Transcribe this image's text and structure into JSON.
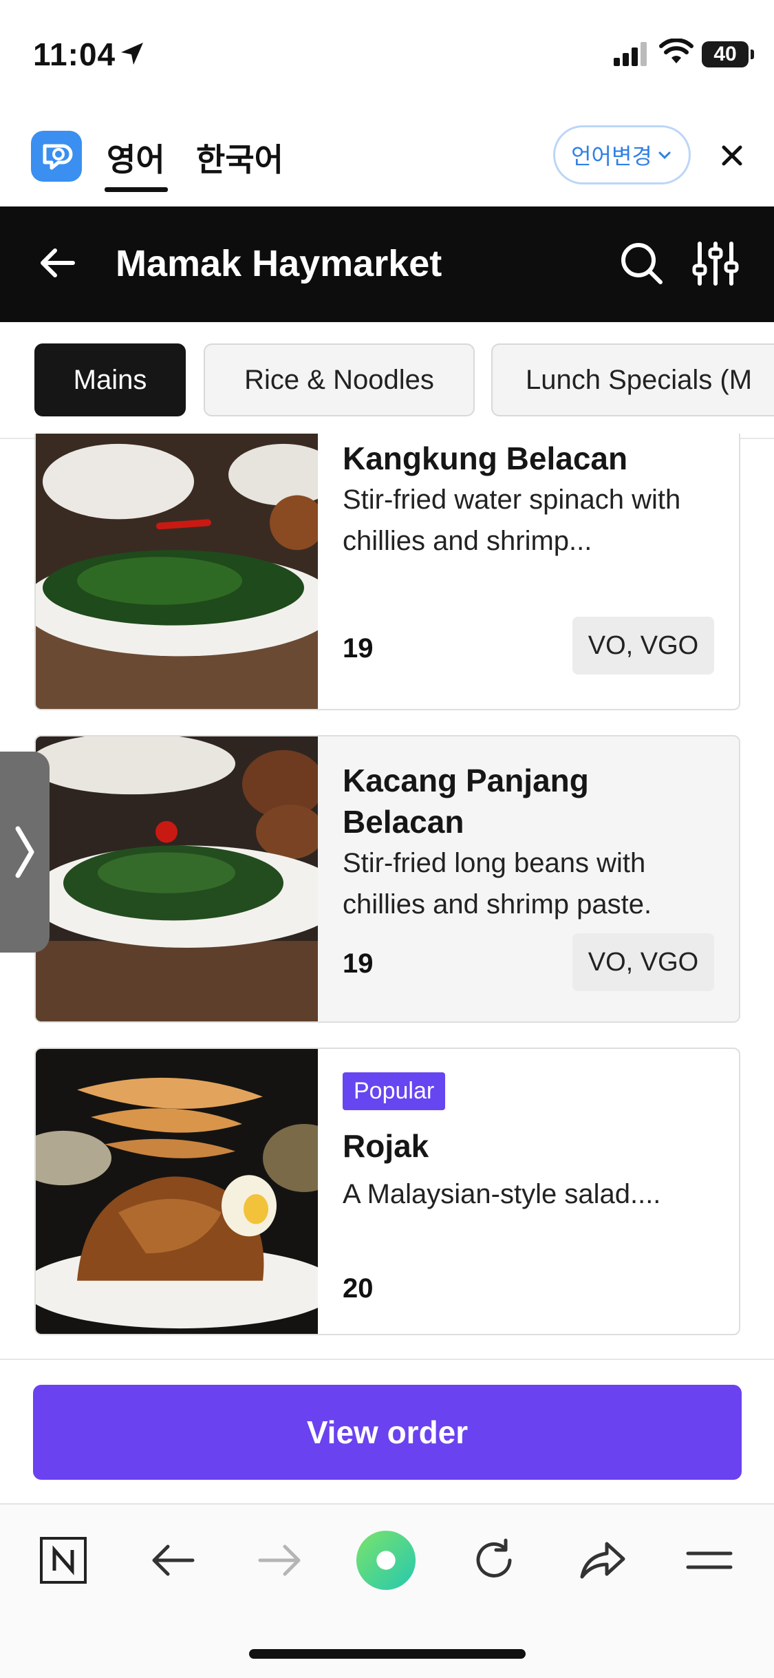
{
  "status_bar": {
    "time": "11:04",
    "battery": "40"
  },
  "translate_bar": {
    "lang_english": "영어",
    "lang_korean": "한국어",
    "change_language": "언어변경"
  },
  "header": {
    "title": "Mamak Haymarket"
  },
  "categories": [
    "Mains",
    "Rice & Noodles",
    "Lunch Specials (M"
  ],
  "items": [
    {
      "name": "Kangkung Belacan",
      "description": "Stir-fried water spinach with chillies and shrimp...",
      "price": "19",
      "tags": "VO, VGO"
    },
    {
      "name": "Kacang Panjang Belacan",
      "description": "Stir-fried long beans with chillies and shrimp paste.",
      "price": "19",
      "tags": "VO, VGO"
    },
    {
      "badge": "Popular",
      "name": "Rojak",
      "description": "A Malaysian-style salad....",
      "price": "20"
    }
  ],
  "view_order": "View order",
  "icons": {
    "side_handle": "chevron-right-icon",
    "browser": [
      "naver-n-icon",
      "back-arrow-icon",
      "forward-arrow-icon",
      "green-dot-icon",
      "reload-icon",
      "share-icon",
      "menu-icon"
    ]
  },
  "colors": {
    "accent": "#6a42ef",
    "header_bg": "#0d0d0d",
    "link_blue": "#2f7fe5"
  }
}
